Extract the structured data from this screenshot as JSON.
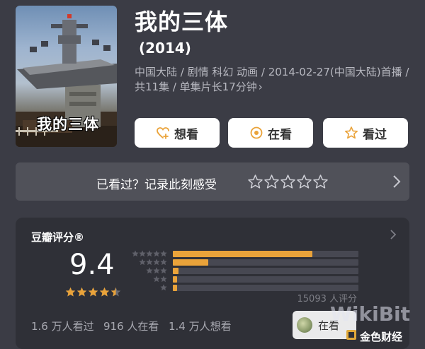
{
  "poster": {
    "caption": "我的三体",
    "icon": "poster-image"
  },
  "header": {
    "title": "我的三体",
    "year": "(2014)",
    "meta": "中国大陆 / 剧情 科幻 动画 / 2014-02-27(中国大陆)首播 / 共11集 / 单集片长17分钟"
  },
  "actions": {
    "want": "想看",
    "watching": "在看",
    "watched": "看过"
  },
  "mark": {
    "prompt": "已看过？记录此刻感受",
    "star_count": 5
  },
  "rating": {
    "title": "豆瓣评分®",
    "score": "9.4",
    "stars": 4.5,
    "distribution": [
      {
        "stars": 5,
        "fraction": 0.75
      },
      {
        "stars": 4,
        "fraction": 0.19
      },
      {
        "stars": 3,
        "fraction": 0.03
      },
      {
        "stars": 2,
        "fraction": 0.01
      },
      {
        "stars": 1,
        "fraction": 0.01
      }
    ],
    "votes": "15093 人评分"
  },
  "stats": {
    "watched": "1.6 万人看过",
    "watching": "916 人在看",
    "want": "1.4 万人想看"
  },
  "watch_badge": {
    "label": "在看"
  },
  "watermark": {
    "brand": "WikiBit",
    "cn": "金色财经"
  },
  "colors": {
    "background": "#3b3c45",
    "accent": "#eaa33a",
    "card": "#2f3037"
  }
}
